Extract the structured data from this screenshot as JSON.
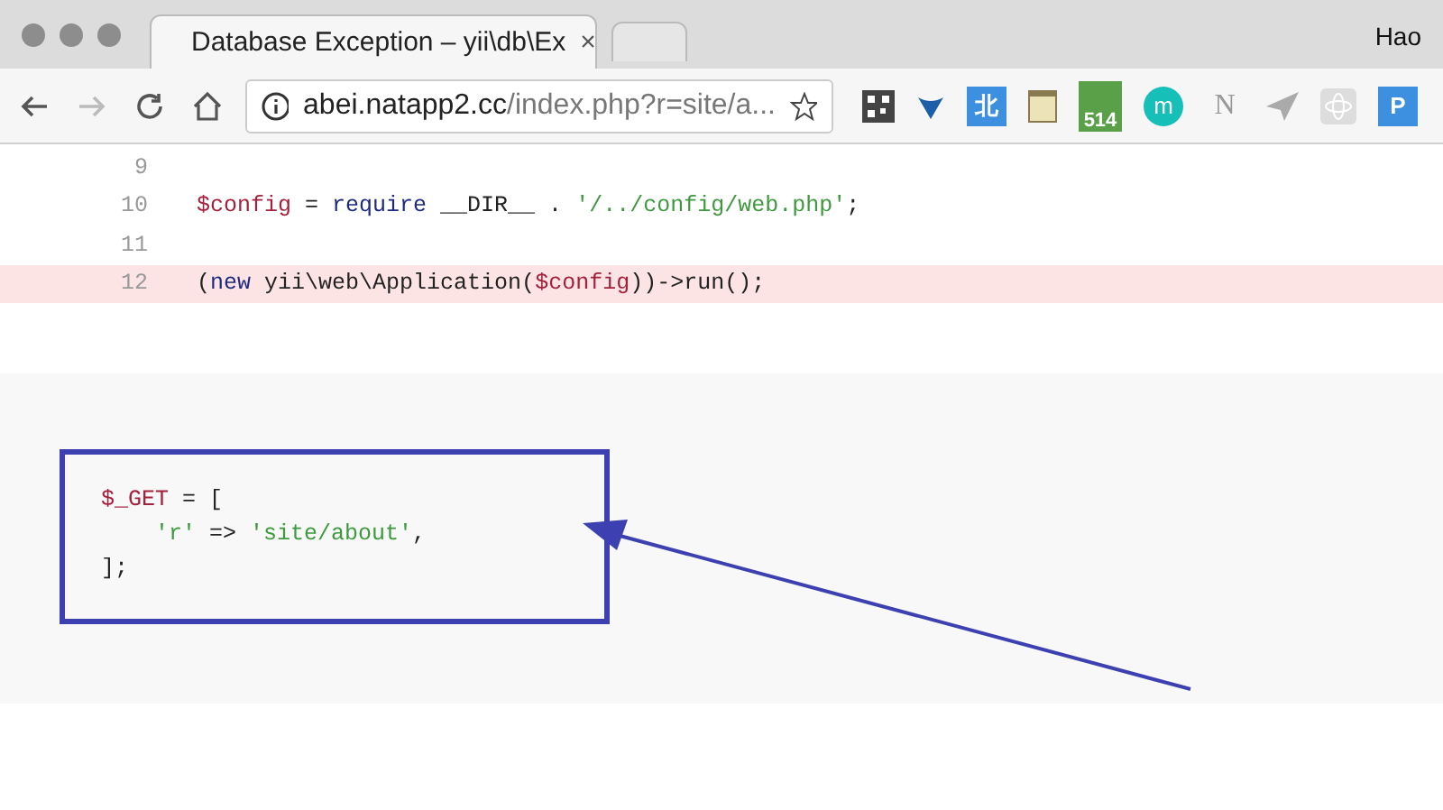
{
  "window": {
    "user": "Hao"
  },
  "tabs": [
    {
      "title": "Database Exception – yii\\db\\Ex",
      "selected": true,
      "close": "×"
    },
    {
      "selected": false
    }
  ],
  "address_bar": {
    "host": "abei.natapp2.cc",
    "path": "/index.php?r=site/a..."
  },
  "extensions": [
    {
      "kind": "qr"
    },
    {
      "kind": "v"
    },
    {
      "kind": "blue-square",
      "label": "北"
    },
    {
      "kind": "notebook"
    },
    {
      "kind": "badge",
      "label": "514"
    },
    {
      "kind": "circle",
      "label": "m"
    },
    {
      "kind": "letter",
      "label": "N"
    },
    {
      "kind": "bird"
    },
    {
      "kind": "atom"
    },
    {
      "kind": "blue-square",
      "label": "P"
    }
  ],
  "code_lines": [
    {
      "number": "9",
      "highlighted": false
    },
    {
      "number": "10",
      "highlighted": false,
      "tokens": [
        {
          "text": "$config",
          "kind": "var"
        },
        {
          "text": " = ",
          "kind": "plain"
        },
        {
          "text": "require",
          "kind": "keyword"
        },
        {
          "text": " __DIR__ . ",
          "kind": "plain"
        },
        {
          "text": "'/../config/web.php'",
          "kind": "string"
        },
        {
          "text": ";",
          "kind": "plain"
        }
      ]
    },
    {
      "number": "11",
      "highlighted": false
    },
    {
      "number": "12",
      "highlighted": true,
      "tokens": [
        {
          "text": "(",
          "kind": "plain"
        },
        {
          "text": "new",
          "kind": "keyword"
        },
        {
          "text": " yii\\web\\Application(",
          "kind": "plain"
        },
        {
          "text": "$config",
          "kind": "var"
        },
        {
          "text": "))->run();",
          "kind": "plain"
        }
      ]
    }
  ],
  "request_params": [
    [
      {
        "text": "$_GET",
        "kind": "var"
      },
      {
        "text": " = [",
        "kind": "plain"
      }
    ],
    [
      {
        "text": "    'r'",
        "kind": "string"
      },
      {
        "text": " => ",
        "kind": "plain"
      },
      {
        "text": "'site/about'",
        "kind": "string"
      },
      {
        "text": ",",
        "kind": "plain"
      }
    ],
    [
      {
        "text": "];",
        "kind": "plain"
      }
    ]
  ]
}
